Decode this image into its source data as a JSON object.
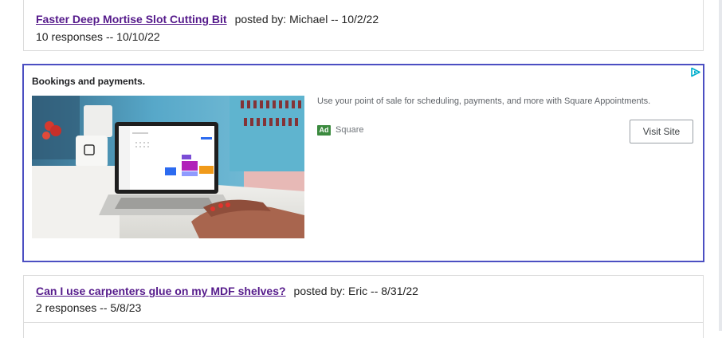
{
  "posts": [
    {
      "title": "Faster Deep Mortise Slot Cutting Bit",
      "meta": "posted by: Michael -- 10/2/22",
      "responses": "10 responses -- 10/10/22"
    },
    {
      "title": "Can I use carpenters glue on my MDF shelves?",
      "meta": "posted by: Eric -- 8/31/22",
      "responses": "2 responses -- 5/8/23"
    }
  ],
  "ad": {
    "headline": "Bookings and payments.",
    "description": "Use your point of sale for scheduling, payments, and more with Square Appointments.",
    "badge": "Ad",
    "advertiser": "Square",
    "cta": "Visit Site",
    "border_color": "#4c4fc2",
    "badge_color": "#3b8a3e"
  },
  "colors": {
    "visited_link": "#551a8b"
  }
}
